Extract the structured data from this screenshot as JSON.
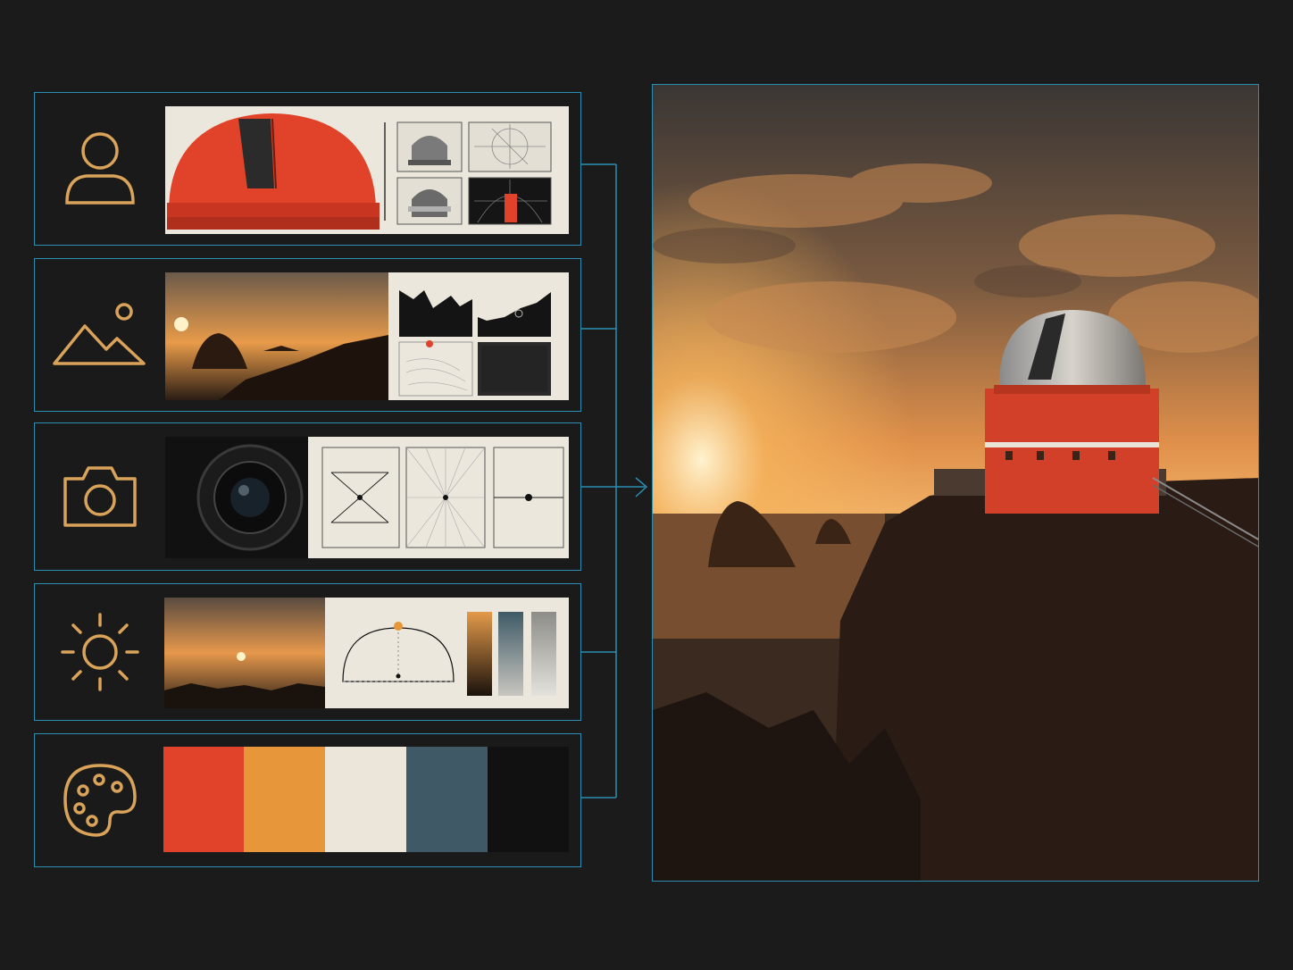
{
  "panels": [
    {
      "id": "subject",
      "icon": "person-icon"
    },
    {
      "id": "environment",
      "icon": "mountain-sun-icon"
    },
    {
      "id": "camera",
      "icon": "camera-icon"
    },
    {
      "id": "lighting",
      "icon": "sun-icon"
    },
    {
      "id": "palette",
      "icon": "palette-icon"
    }
  ],
  "palette_colors": [
    "#e0432a",
    "#e8963a",
    "#ece6da",
    "#3f5a66",
    "#111111"
  ],
  "lighting_gradients": [
    [
      "#e39a4a",
      "#1a120c"
    ],
    [
      "#3f5a66",
      "#c8c6bf"
    ],
    [
      "#8c8c88",
      "#e4e2dc"
    ]
  ],
  "colors": {
    "accent_border": "#2a8fb3",
    "icon_stroke": "#d9a35a",
    "dome_red": "#e0432a",
    "background": "#1b1b1b"
  },
  "output": {
    "description_icon": "output-image"
  }
}
